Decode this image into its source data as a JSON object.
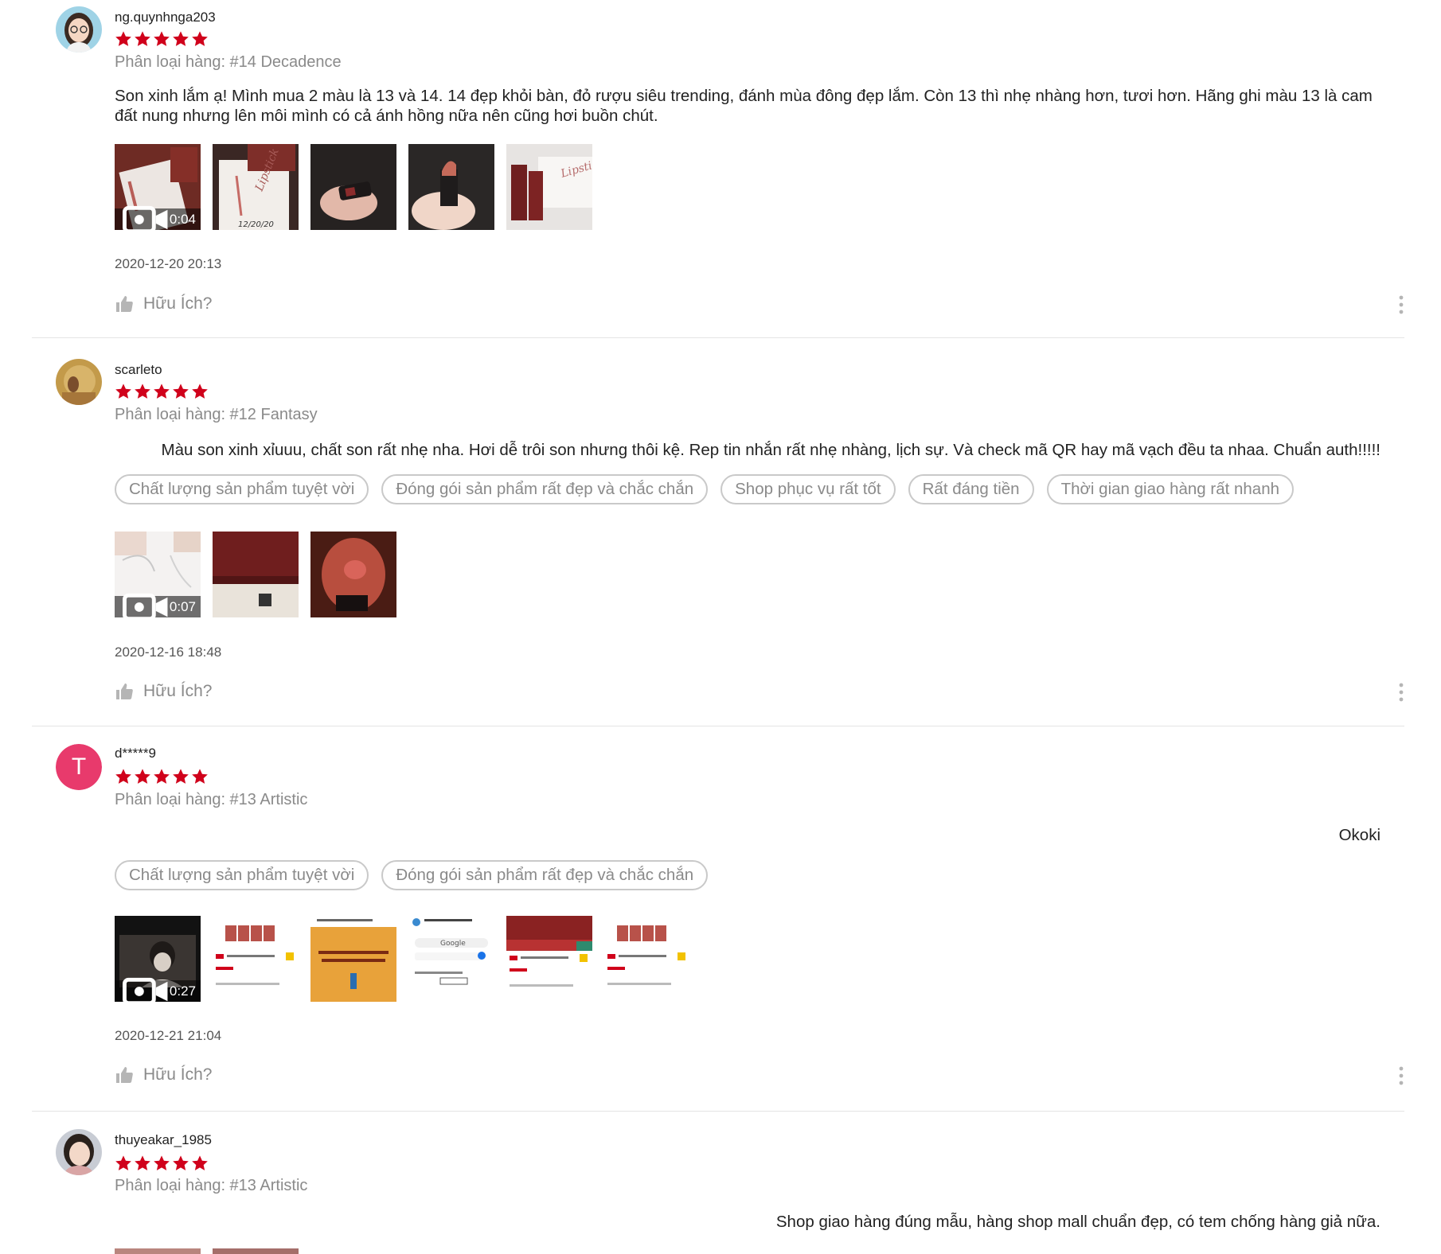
{
  "helpful_label": "Hữu Ích?",
  "colors": {
    "star": "#d0011b",
    "avatar_letter_bg": "#e83a6c"
  },
  "reviews": [
    {
      "username": "ng.quynhnga203",
      "rating": 5,
      "variant": "Phân loại hàng: #14 Decadence",
      "comment": "Son xinh lắm ạ! Mình mua 2 màu là 13 và 14. 14 đẹp khỏi bàn, đỏ rượu siêu trending, đánh mùa đông đẹp lắm. Còn 13 thì nhẹ nhàng hơn, tươi hơn. Hãng ghi màu 13 là cam đất nung nhưng lên môi mình có cả ánh hồng nữa nên cũng hơi buồn chút.",
      "tags": [],
      "video_duration": "0:04",
      "photo_texts": [
        "12/20/20",
        "Lipstick"
      ],
      "date": "2020-12-20 20:13"
    },
    {
      "username": "scarleto",
      "rating": 5,
      "variant": "Phân loại hàng: #12 Fantasy",
      "comment": "Màu son xinh xỉuuu, chất son rất nhẹ nha. Hơi dễ trôi son nhưng thôi kệ. Rep tin nhắn rất nhẹ nhàng, lịch sự. Và check mã QR hay mã vạch đều ta nhaa. Chuẩn auth!!!!!",
      "tags": [
        "Chất lượng sản phẩm tuyệt vời",
        "Đóng gói sản phẩm rất đẹp và chắc chắn",
        "Shop phục vụ rất tốt",
        "Rất đáng tiền",
        "Thời gian giao hàng rất nhanh"
      ],
      "video_duration": "0:07",
      "date": "2020-12-16 18:48"
    },
    {
      "username": "d*****9",
      "avatar_letter": "T",
      "rating": 5,
      "variant": "Phân loại hàng: #13 Artistic",
      "comment": "Okoki",
      "tags": [
        "Chất lượng sản phẩm tuyệt vời",
        "Đóng gói sản phẩm rất đẹp và chắc chắn"
      ],
      "video_duration": "0:27",
      "photo_texts": [
        "Google"
      ],
      "date": "2020-12-21 21:04"
    },
    {
      "username": "thuyeakar_1985",
      "rating": 5,
      "variant": "Phân loại hàng: #13 Artistic",
      "comment": "Shop giao hàng đúng mẫu, hàng shop mall chuẩn đẹp, có tem chống hàng giả nữa.",
      "tags": []
    }
  ]
}
